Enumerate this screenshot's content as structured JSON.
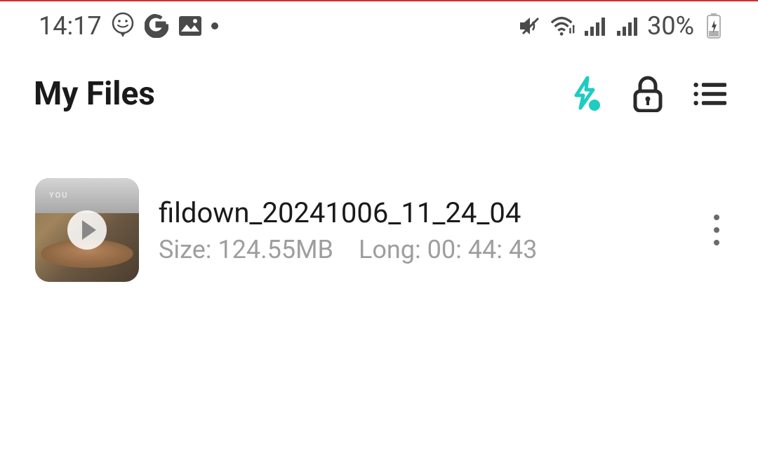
{
  "statusbar": {
    "time": "14:17",
    "battery_percent": "30%"
  },
  "header": {
    "title": "My Files"
  },
  "files": [
    {
      "name": "fildown_20241006_11_24_04",
      "size_label": "Size: 124.55MB",
      "long_label": "Long: 00: 44: 43",
      "thumbnail_tag": "YOU"
    }
  ]
}
